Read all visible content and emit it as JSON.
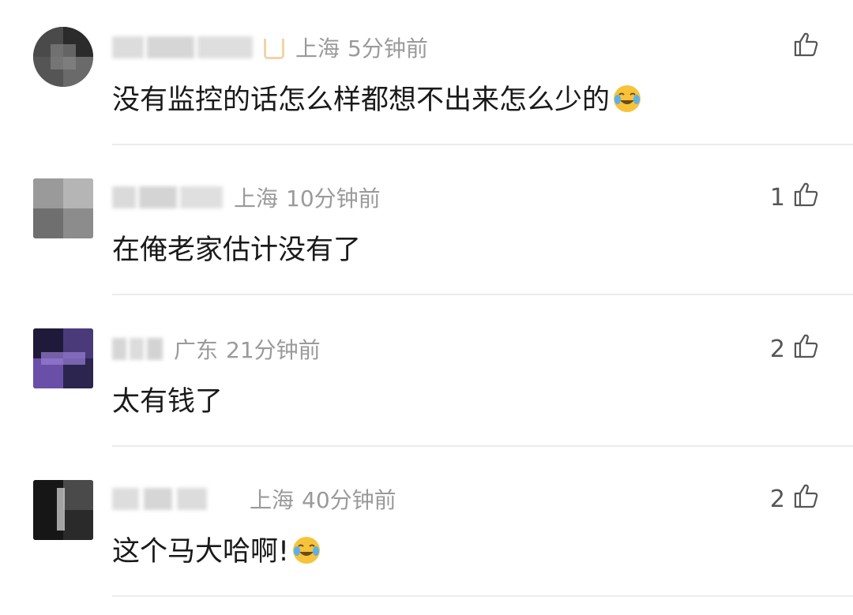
{
  "comments": [
    {
      "location": "上海",
      "time": "5分钟前",
      "text": "没有监控的话怎么样都想不出来怎么少的",
      "likes": "",
      "has_emoji": true,
      "emoji": "laugh-cry-emoji"
    },
    {
      "location": "上海",
      "time": "10分钟前",
      "text": "在俺老家估计没有了",
      "likes": "1",
      "has_emoji": false
    },
    {
      "location": "广东",
      "time": "21分钟前",
      "text": "太有钱了",
      "likes": "2",
      "has_emoji": false
    },
    {
      "location": "上海",
      "time": "40分钟前",
      "text": "这个马大哈啊!",
      "likes": "2",
      "has_emoji": true,
      "emoji": "laugh-cry-emoji"
    }
  ],
  "icons": {
    "like": "thumbs-up-icon",
    "emoji": "laugh-cry-emoji"
  },
  "colors": {
    "meta_text": "#9a9a9a",
    "content_text": "#1a1a1a",
    "divider": "#ececec",
    "badge": "#f1d3a8",
    "emoji": "#f7c33a"
  }
}
